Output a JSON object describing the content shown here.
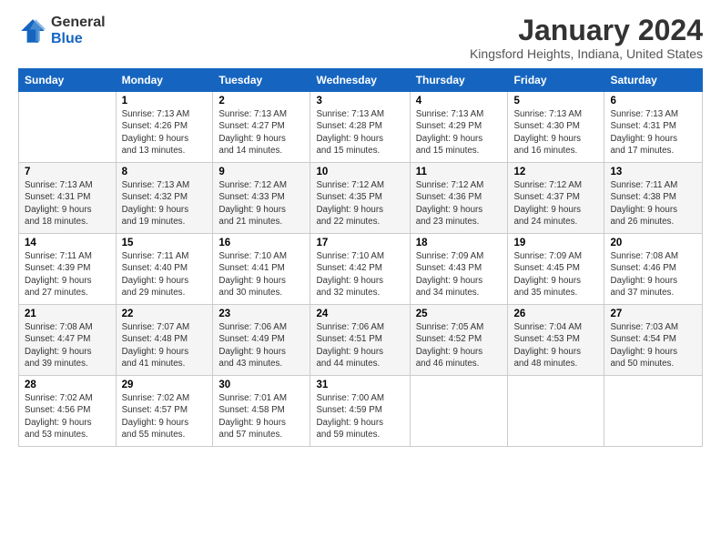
{
  "logo": {
    "line1": "General",
    "line2": "Blue"
  },
  "title": "January 2024",
  "subtitle": "Kingsford Heights, Indiana, United States",
  "weekdays": [
    "Sunday",
    "Monday",
    "Tuesday",
    "Wednesday",
    "Thursday",
    "Friday",
    "Saturday"
  ],
  "weeks": [
    [
      {
        "day": "",
        "info": ""
      },
      {
        "day": "1",
        "info": "Sunrise: 7:13 AM\nSunset: 4:26 PM\nDaylight: 9 hours\nand 13 minutes."
      },
      {
        "day": "2",
        "info": "Sunrise: 7:13 AM\nSunset: 4:27 PM\nDaylight: 9 hours\nand 14 minutes."
      },
      {
        "day": "3",
        "info": "Sunrise: 7:13 AM\nSunset: 4:28 PM\nDaylight: 9 hours\nand 15 minutes."
      },
      {
        "day": "4",
        "info": "Sunrise: 7:13 AM\nSunset: 4:29 PM\nDaylight: 9 hours\nand 15 minutes."
      },
      {
        "day": "5",
        "info": "Sunrise: 7:13 AM\nSunset: 4:30 PM\nDaylight: 9 hours\nand 16 minutes."
      },
      {
        "day": "6",
        "info": "Sunrise: 7:13 AM\nSunset: 4:31 PM\nDaylight: 9 hours\nand 17 minutes."
      }
    ],
    [
      {
        "day": "7",
        "info": "Sunrise: 7:13 AM\nSunset: 4:31 PM\nDaylight: 9 hours\nand 18 minutes."
      },
      {
        "day": "8",
        "info": "Sunrise: 7:13 AM\nSunset: 4:32 PM\nDaylight: 9 hours\nand 19 minutes."
      },
      {
        "day": "9",
        "info": "Sunrise: 7:12 AM\nSunset: 4:33 PM\nDaylight: 9 hours\nand 21 minutes."
      },
      {
        "day": "10",
        "info": "Sunrise: 7:12 AM\nSunset: 4:35 PM\nDaylight: 9 hours\nand 22 minutes."
      },
      {
        "day": "11",
        "info": "Sunrise: 7:12 AM\nSunset: 4:36 PM\nDaylight: 9 hours\nand 23 minutes."
      },
      {
        "day": "12",
        "info": "Sunrise: 7:12 AM\nSunset: 4:37 PM\nDaylight: 9 hours\nand 24 minutes."
      },
      {
        "day": "13",
        "info": "Sunrise: 7:11 AM\nSunset: 4:38 PM\nDaylight: 9 hours\nand 26 minutes."
      }
    ],
    [
      {
        "day": "14",
        "info": "Sunrise: 7:11 AM\nSunset: 4:39 PM\nDaylight: 9 hours\nand 27 minutes."
      },
      {
        "day": "15",
        "info": "Sunrise: 7:11 AM\nSunset: 4:40 PM\nDaylight: 9 hours\nand 29 minutes."
      },
      {
        "day": "16",
        "info": "Sunrise: 7:10 AM\nSunset: 4:41 PM\nDaylight: 9 hours\nand 30 minutes."
      },
      {
        "day": "17",
        "info": "Sunrise: 7:10 AM\nSunset: 4:42 PM\nDaylight: 9 hours\nand 32 minutes."
      },
      {
        "day": "18",
        "info": "Sunrise: 7:09 AM\nSunset: 4:43 PM\nDaylight: 9 hours\nand 34 minutes."
      },
      {
        "day": "19",
        "info": "Sunrise: 7:09 AM\nSunset: 4:45 PM\nDaylight: 9 hours\nand 35 minutes."
      },
      {
        "day": "20",
        "info": "Sunrise: 7:08 AM\nSunset: 4:46 PM\nDaylight: 9 hours\nand 37 minutes."
      }
    ],
    [
      {
        "day": "21",
        "info": "Sunrise: 7:08 AM\nSunset: 4:47 PM\nDaylight: 9 hours\nand 39 minutes."
      },
      {
        "day": "22",
        "info": "Sunrise: 7:07 AM\nSunset: 4:48 PM\nDaylight: 9 hours\nand 41 minutes."
      },
      {
        "day": "23",
        "info": "Sunrise: 7:06 AM\nSunset: 4:49 PM\nDaylight: 9 hours\nand 43 minutes."
      },
      {
        "day": "24",
        "info": "Sunrise: 7:06 AM\nSunset: 4:51 PM\nDaylight: 9 hours\nand 44 minutes."
      },
      {
        "day": "25",
        "info": "Sunrise: 7:05 AM\nSunset: 4:52 PM\nDaylight: 9 hours\nand 46 minutes."
      },
      {
        "day": "26",
        "info": "Sunrise: 7:04 AM\nSunset: 4:53 PM\nDaylight: 9 hours\nand 48 minutes."
      },
      {
        "day": "27",
        "info": "Sunrise: 7:03 AM\nSunset: 4:54 PM\nDaylight: 9 hours\nand 50 minutes."
      }
    ],
    [
      {
        "day": "28",
        "info": "Sunrise: 7:02 AM\nSunset: 4:56 PM\nDaylight: 9 hours\nand 53 minutes."
      },
      {
        "day": "29",
        "info": "Sunrise: 7:02 AM\nSunset: 4:57 PM\nDaylight: 9 hours\nand 55 minutes."
      },
      {
        "day": "30",
        "info": "Sunrise: 7:01 AM\nSunset: 4:58 PM\nDaylight: 9 hours\nand 57 minutes."
      },
      {
        "day": "31",
        "info": "Sunrise: 7:00 AM\nSunset: 4:59 PM\nDaylight: 9 hours\nand 59 minutes."
      },
      {
        "day": "",
        "info": ""
      },
      {
        "day": "",
        "info": ""
      },
      {
        "day": "",
        "info": ""
      }
    ]
  ]
}
